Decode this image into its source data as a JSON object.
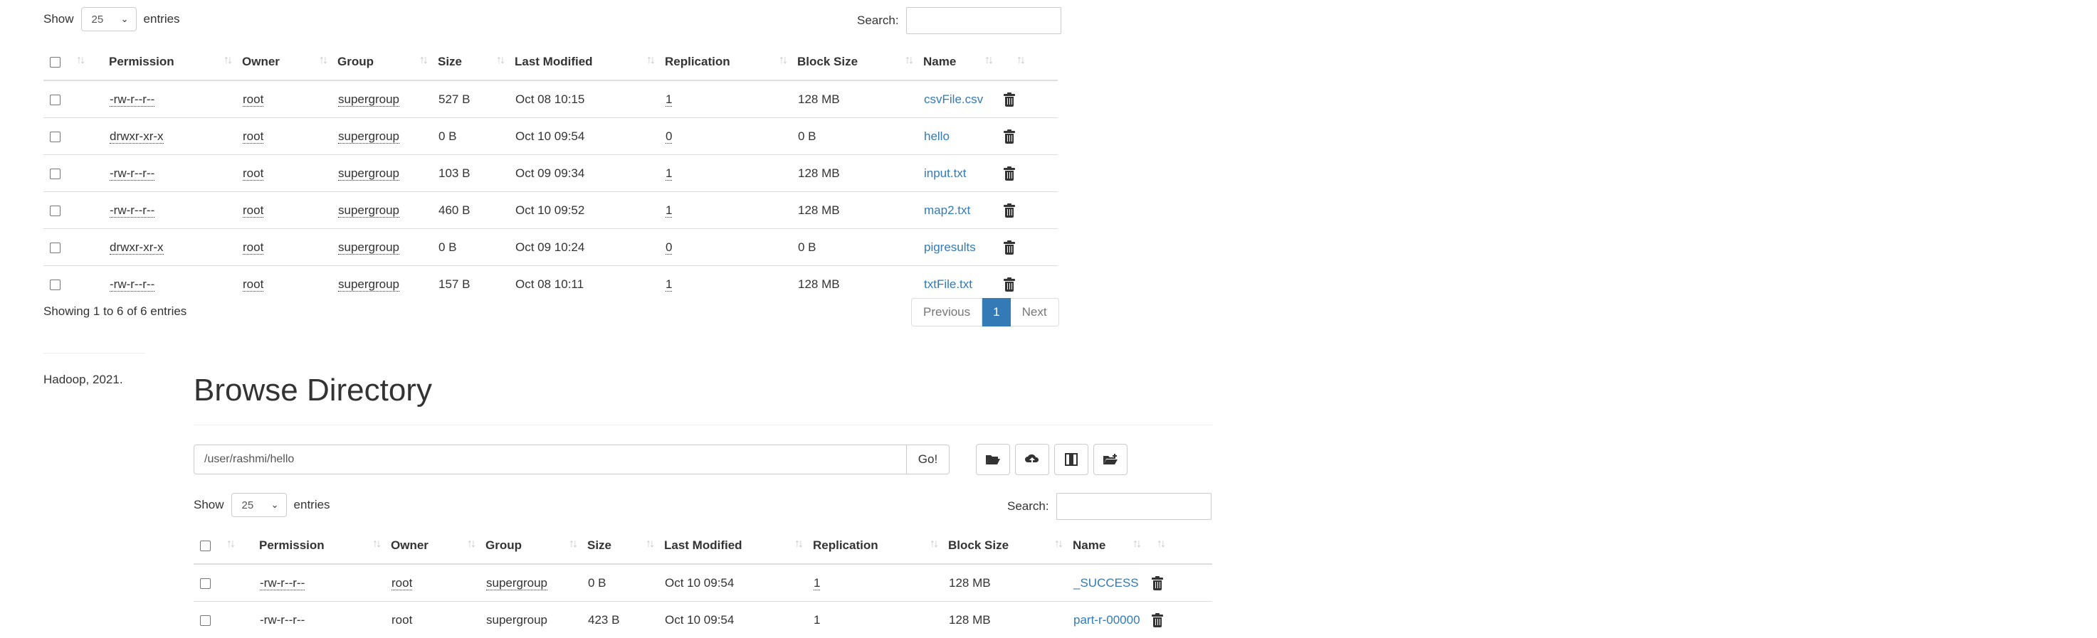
{
  "top": {
    "length": {
      "show_label": "Show",
      "value": "25",
      "entries_label": "entries"
    },
    "search_label": "Search:",
    "columns": [
      "Permission",
      "Owner",
      "Group",
      "Size",
      "Last Modified",
      "Replication",
      "Block Size",
      "Name"
    ],
    "rows": [
      {
        "permission": "-rw-r--r--",
        "owner": "root",
        "group": "supergroup",
        "size": "527 B",
        "modified": "Oct 08 10:15",
        "replication": "1",
        "block": "128 MB",
        "name": "csvFile.csv"
      },
      {
        "permission": "drwxr-xr-x",
        "owner": "root",
        "group": "supergroup",
        "size": "0 B",
        "modified": "Oct 10 09:54",
        "replication": "0",
        "block": "0 B",
        "name": "hello"
      },
      {
        "permission": "-rw-r--r--",
        "owner": "root",
        "group": "supergroup",
        "size": "103 B",
        "modified": "Oct 09 09:34",
        "replication": "1",
        "block": "128 MB",
        "name": "input.txt"
      },
      {
        "permission": "-rw-r--r--",
        "owner": "root",
        "group": "supergroup",
        "size": "460 B",
        "modified": "Oct 10 09:52",
        "replication": "1",
        "block": "128 MB",
        "name": "map2.txt"
      },
      {
        "permission": "drwxr-xr-x",
        "owner": "root",
        "group": "supergroup",
        "size": "0 B",
        "modified": "Oct 09 10:24",
        "replication": "0",
        "block": "0 B",
        "name": "pigresults"
      },
      {
        "permission": "-rw-r--r--",
        "owner": "root",
        "group": "supergroup",
        "size": "157 B",
        "modified": "Oct 08 10:11",
        "replication": "1",
        "block": "128 MB",
        "name": "txtFile.txt"
      }
    ],
    "info": "Showing 1 to 6 of 6 entries",
    "pager": {
      "previous": "Previous",
      "current": "1",
      "next": "Next"
    }
  },
  "footer": {
    "text": "Hadoop, 2021."
  },
  "browse": {
    "title": "Browse Directory",
    "path_value": "/user/rashmi/hello",
    "go_label": "Go!",
    "toolbar_icons": [
      "folder-open-icon",
      "cloud-upload-icon",
      "column-icon",
      "folder-create-icon"
    ],
    "length": {
      "show_label": "Show",
      "value": "25",
      "entries_label": "entries"
    },
    "search_label": "Search:",
    "columns": [
      "Permission",
      "Owner",
      "Group",
      "Size",
      "Last Modified",
      "Replication",
      "Block Size",
      "Name"
    ],
    "rows": [
      {
        "permission": "-rw-r--r--",
        "owner": "root",
        "group": "supergroup",
        "size": "0 B",
        "modified": "Oct 10 09:54",
        "replication": "1",
        "block": "128 MB",
        "name": "_SUCCESS"
      },
      {
        "permission": "-rw-r--r--",
        "owner": "root",
        "group": "supergroup",
        "size": "423 B",
        "modified": "Oct 10 09:54",
        "replication": "1",
        "block": "128 MB",
        "name": "part-r-00000"
      }
    ]
  },
  "colors": {
    "link": "#337ab7",
    "active_page": "#337ab7",
    "border": "#dddddd"
  }
}
